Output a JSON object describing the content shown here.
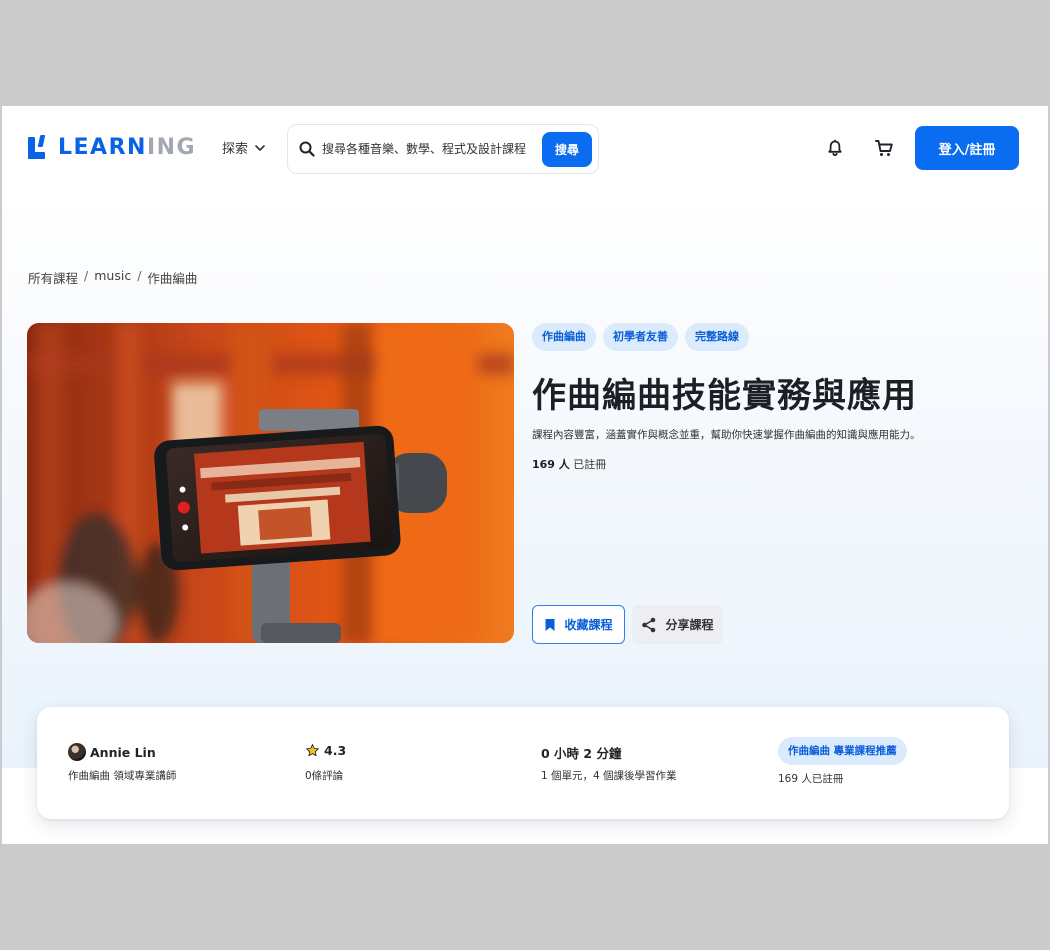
{
  "header": {
    "logo": {
      "part1": "LEARN",
      "part2": "ING"
    },
    "explore_label": "探索",
    "search": {
      "placeholder": "搜尋各種音樂、數學、程式及設計課程",
      "button_label": "搜尋"
    },
    "login_label": "登入/註冊"
  },
  "breadcrumb": [
    "所有課程",
    "music",
    "作曲編曲"
  ],
  "course": {
    "tags": [
      "作曲編曲",
      "初學者友善",
      "完整路線"
    ],
    "title": "作曲編曲技能實務與應用",
    "description": "課程內容豐富，涵蓋實作與概念並重，幫助你快速掌握作曲編曲的知識與應用能力。",
    "enrolled_count": "169 人",
    "enrolled_suffix": "已註冊",
    "save_label": "收藏課程",
    "share_label": "分享課程"
  },
  "info": {
    "instructor": {
      "name": "Annie Lin",
      "role": "作曲編曲 領域專業講師"
    },
    "rating": {
      "value": "4.3",
      "reviews": "0條評論"
    },
    "duration": {
      "value": "0 小時 2 分鐘",
      "detail": "1 個單元，4 個課後學習作業"
    },
    "recommend": {
      "badge": "作曲編曲 專業課程推薦",
      "enrolled": "169 人已註冊"
    }
  },
  "colors": {
    "primary": "#0a6cf0",
    "tag_bg": "#dcebfc",
    "tag_text": "#0a5ed8",
    "logo_gray": "#a3a8b0"
  }
}
